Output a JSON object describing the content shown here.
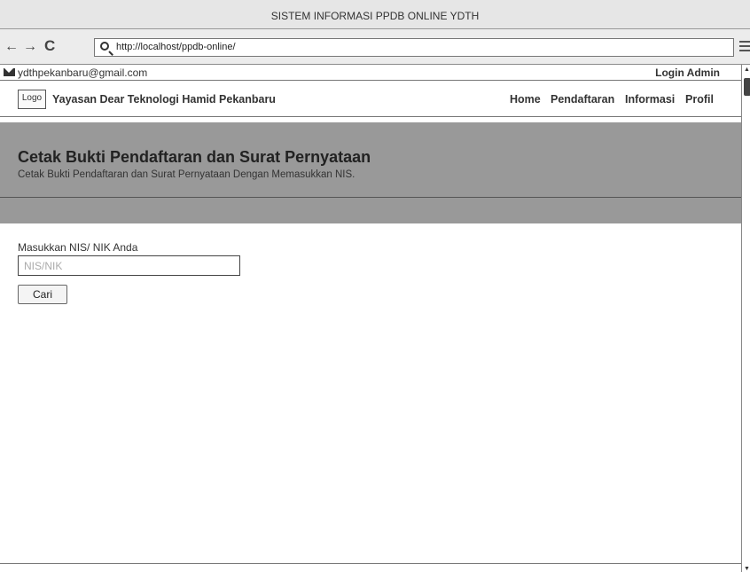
{
  "window": {
    "title": "SISTEM INFORMASI PPDB ONLINE YDTH"
  },
  "browser": {
    "back_glyph": "🡐",
    "forward_glyph": "🡒",
    "reload_glyph": "C",
    "url": "http://localhost/ppdb-online/"
  },
  "topbar": {
    "email": "ydthpekanbaru@gmail.com",
    "login": "Login Admin"
  },
  "header": {
    "logo": "Logo",
    "site_name": "Yayasan Dear Teknologi Hamid Pekanbaru",
    "menu": [
      "Home",
      "Pendaftaran",
      "Informasi",
      "Profil"
    ]
  },
  "hero": {
    "title": "Cetak Bukti Pendaftaran dan Surat Pernyataan",
    "subtitle": "Cetak Bukti Pendaftaran dan Surat Pernyataan Dengan Memasukkan NIS."
  },
  "form": {
    "label": "Masukkan NIS/ NIK Anda",
    "placeholder": "NIS/NIK",
    "value": "",
    "button": "Cari"
  },
  "icons": [
    "back-arrow-icon",
    "forward-arrow-icon",
    "reload-icon",
    "search-icon",
    "hamburger-menu-icon",
    "mail-icon"
  ]
}
